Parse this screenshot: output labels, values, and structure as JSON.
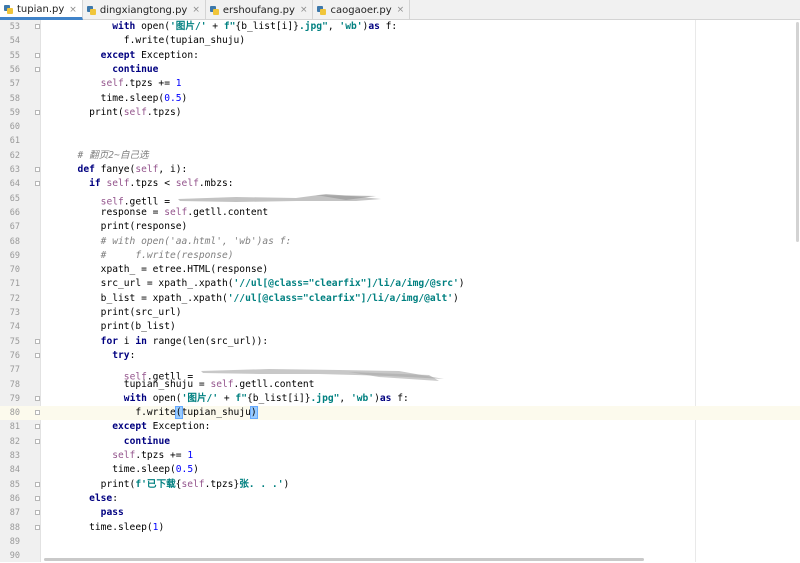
{
  "tabs": [
    {
      "label": "tupian.py",
      "active": true
    },
    {
      "label": "dingxiangtong.py",
      "active": false
    },
    {
      "label": "ershoufang.py",
      "active": false
    },
    {
      "label": "caogaoer.py",
      "active": false
    }
  ],
  "current_line": 80,
  "lines": [
    {
      "n": "53",
      "indent": 8,
      "tokens": [
        [
          "kw",
          "with "
        ],
        [
          "",
          "open("
        ],
        [
          "str",
          "'图片/'"
        ],
        [
          "",
          " + "
        ],
        [
          "str",
          "f\""
        ],
        [
          "",
          "{b_list[i]}"
        ],
        [
          "str",
          ".jpg\""
        ],
        [
          "",
          ", "
        ],
        [
          "str",
          "'wb'"
        ],
        [
          "",
          ")"
        ],
        [
          "kw",
          "as "
        ],
        [
          "",
          "f:"
        ]
      ]
    },
    {
      "n": "54",
      "indent": 10,
      "tokens": [
        [
          "",
          "f.write(tupian_shuju)"
        ]
      ]
    },
    {
      "n": "55",
      "indent": 6,
      "tokens": [
        [
          "kw",
          "except "
        ],
        [
          "",
          "Exception:"
        ]
      ]
    },
    {
      "n": "56",
      "indent": 8,
      "tokens": [
        [
          "kw",
          "continue"
        ]
      ]
    },
    {
      "n": "57",
      "indent": 6,
      "tokens": [
        [
          "self",
          "self"
        ],
        [
          "",
          ".tpzs += "
        ],
        [
          "num",
          "1"
        ]
      ]
    },
    {
      "n": "58",
      "indent": 6,
      "tokens": [
        [
          "",
          "time.sleep("
        ],
        [
          "num",
          "0.5"
        ],
        [
          "",
          ")"
        ]
      ]
    },
    {
      "n": "59",
      "indent": 4,
      "tokens": [
        [
          "",
          "print("
        ],
        [
          "self",
          "self"
        ],
        [
          "",
          ".tpzs)"
        ]
      ]
    },
    {
      "n": "60",
      "indent": 0,
      "tokens": []
    },
    {
      "n": "61",
      "indent": 0,
      "tokens": []
    },
    {
      "n": "62",
      "indent": 2,
      "tokens": [
        [
          "cmt",
          "# 翻页2~自己选"
        ]
      ]
    },
    {
      "n": "63",
      "indent": 2,
      "tokens": [
        [
          "kw",
          "def "
        ],
        [
          "",
          "fanye("
        ],
        [
          "self",
          "self"
        ],
        [
          "",
          ", i):"
        ]
      ]
    },
    {
      "n": "64",
      "indent": 4,
      "tokens": [
        [
          "kw",
          "if "
        ],
        [
          "self",
          "self"
        ],
        [
          "",
          ".tpzs < "
        ],
        [
          "self",
          "self"
        ],
        [
          "",
          ".mbzs:"
        ]
      ]
    },
    {
      "n": "65",
      "indent": 6,
      "tokens": [
        [
          "self",
          "self"
        ],
        [
          "",
          ".getll = "
        ]
      ],
      "redacted": 1
    },
    {
      "n": "66",
      "indent": 6,
      "tokens": [
        [
          "",
          "response = "
        ],
        [
          "self",
          "self"
        ],
        [
          "",
          ".getll.content"
        ]
      ]
    },
    {
      "n": "67",
      "indent": 6,
      "tokens": [
        [
          "",
          "print(response)"
        ]
      ]
    },
    {
      "n": "68",
      "indent": 6,
      "tokens": [
        [
          "cmt",
          "# with open('aa.html', 'wb')as f:"
        ]
      ]
    },
    {
      "n": "69",
      "indent": 6,
      "tokens": [
        [
          "cmt",
          "#     f.write(response)"
        ]
      ]
    },
    {
      "n": "70",
      "indent": 6,
      "tokens": [
        [
          "",
          "xpath_ = etree.HTML(response)"
        ]
      ]
    },
    {
      "n": "71",
      "indent": 6,
      "tokens": [
        [
          "",
          "src_url = xpath_.xpath("
        ],
        [
          "str",
          "'//ul[@class=\"clearfix\"]/li/a/img/@src'"
        ],
        [
          "",
          ")"
        ]
      ]
    },
    {
      "n": "72",
      "indent": 6,
      "tokens": [
        [
          "",
          "b_list = xpath_.xpath("
        ],
        [
          "str",
          "'//ul[@class=\"clearfix\"]/li/a/img/@alt'"
        ],
        [
          "",
          ")"
        ]
      ]
    },
    {
      "n": "73",
      "indent": 6,
      "tokens": [
        [
          "",
          "print(src_url)"
        ]
      ]
    },
    {
      "n": "74",
      "indent": 6,
      "tokens": [
        [
          "",
          "print(b_list)"
        ]
      ]
    },
    {
      "n": "75",
      "indent": 6,
      "tokens": [
        [
          "kw",
          "for "
        ],
        [
          "",
          "i "
        ],
        [
          "kw",
          "in "
        ],
        [
          "",
          "range(len(src_url)):"
        ]
      ]
    },
    {
      "n": "76",
      "indent": 8,
      "tokens": [
        [
          "kw",
          "try"
        ],
        [
          "",
          ":"
        ]
      ]
    },
    {
      "n": "77",
      "indent": 10,
      "tokens": [
        [
          "self",
          "self"
        ],
        [
          "",
          ".getll = "
        ]
      ],
      "redacted": 2
    },
    {
      "n": "78",
      "indent": 10,
      "tokens": [
        [
          "",
          "tupian_shuju = "
        ],
        [
          "self",
          "self"
        ],
        [
          "",
          ".getll.content"
        ]
      ]
    },
    {
      "n": "79",
      "indent": 10,
      "tokens": [
        [
          "kw",
          "with "
        ],
        [
          "",
          "open("
        ],
        [
          "str",
          "'图片/'"
        ],
        [
          "",
          " + "
        ],
        [
          "str",
          "f\""
        ],
        [
          "",
          "{b_list[i]}"
        ],
        [
          "str",
          ".jpg\""
        ],
        [
          "",
          ", "
        ],
        [
          "str",
          "'wb'"
        ],
        [
          "",
          ")"
        ],
        [
          "kw",
          "as "
        ],
        [
          "",
          "f:"
        ]
      ]
    },
    {
      "n": "80",
      "indent": 12,
      "tokens": [
        [
          "",
          "f.write(tupian_shuju)"
        ]
      ]
    },
    {
      "n": "81",
      "indent": 8,
      "tokens": [
        [
          "kw",
          "except "
        ],
        [
          "",
          "Exception:"
        ]
      ]
    },
    {
      "n": "82",
      "indent": 10,
      "tokens": [
        [
          "kw",
          "continue"
        ]
      ]
    },
    {
      "n": "83",
      "indent": 8,
      "tokens": [
        [
          "self",
          "self"
        ],
        [
          "",
          ".tpzs += "
        ],
        [
          "num",
          "1"
        ]
      ]
    },
    {
      "n": "84",
      "indent": 8,
      "tokens": [
        [
          "",
          "time.sleep("
        ],
        [
          "num",
          "0.5"
        ],
        [
          "",
          ")"
        ]
      ]
    },
    {
      "n": "85",
      "indent": 6,
      "tokens": [
        [
          "",
          "print("
        ],
        [
          "str",
          "f'已下载"
        ],
        [
          "",
          "{"
        ],
        [
          "self",
          "self"
        ],
        [
          "",
          ".tpzs}"
        ],
        [
          "str",
          "张. . .'"
        ],
        [
          "",
          ")"
        ]
      ]
    },
    {
      "n": "86",
      "indent": 4,
      "tokens": [
        [
          "kw",
          "else"
        ],
        [
          "",
          ":"
        ]
      ]
    },
    {
      "n": "87",
      "indent": 6,
      "tokens": [
        [
          "kw",
          "pass"
        ]
      ]
    },
    {
      "n": "88",
      "indent": 4,
      "tokens": [
        [
          "",
          "time.sleep("
        ],
        [
          "num",
          "1"
        ],
        [
          "",
          ")"
        ]
      ]
    },
    {
      "n": "89",
      "indent": 0,
      "tokens": []
    },
    {
      "n": "90",
      "indent": 0,
      "tokens": []
    }
  ]
}
